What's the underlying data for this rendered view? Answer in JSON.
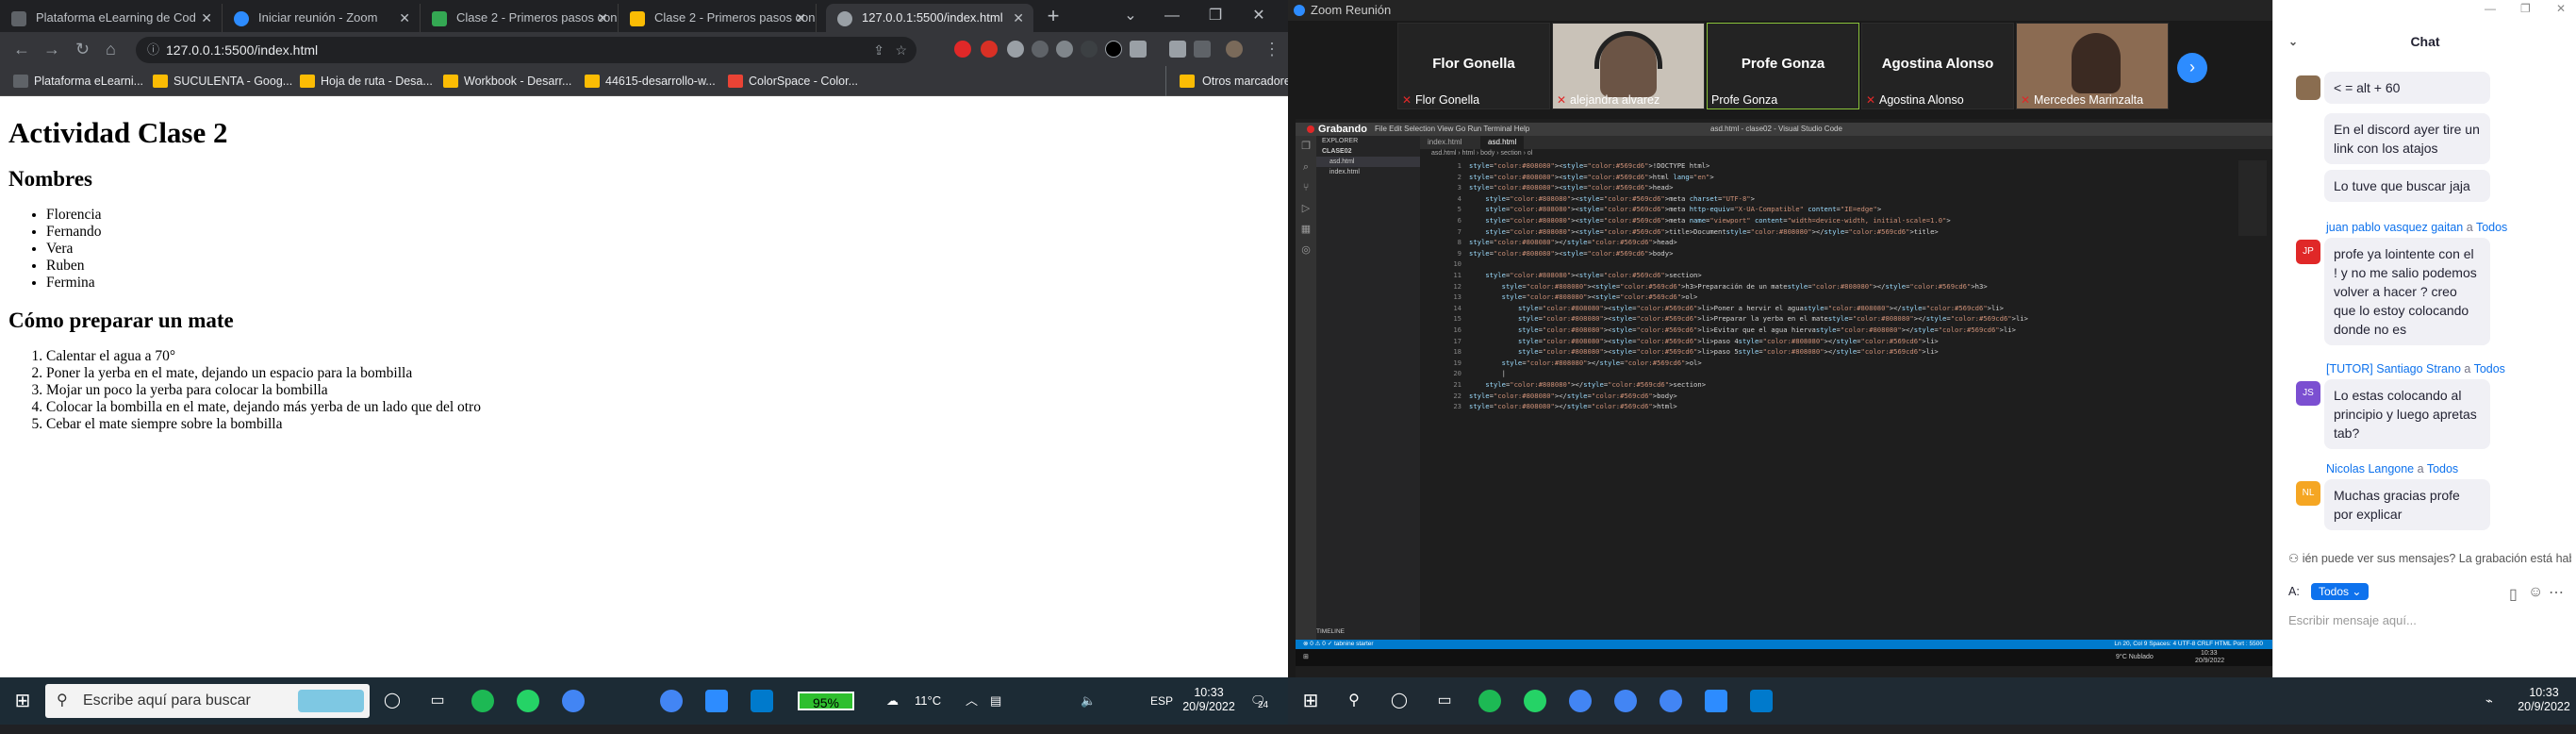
{
  "browser": {
    "tabs": [
      {
        "label": "Plataforma eLearning de Cod",
        "color": "#5f6368"
      },
      {
        "label": "Iniciar reunión - Zoom",
        "color": "#2d8cff"
      },
      {
        "label": "Clase 2 - Primeros pasos con",
        "color": "#34a853"
      },
      {
        "label": "Clase 2 - Primeros pasos con",
        "color": "#fbbc04"
      },
      {
        "label": "127.0.0.1:5500/index.html",
        "color": "#9aa0a6"
      }
    ],
    "new_tab": "+",
    "url": "127.0.0.1:5500/index.html",
    "bookmarks": [
      {
        "label": "Plataforma eLearni...",
        "color": "#5f6368"
      },
      {
        "label": "SUCULENTA - Goog...",
        "color": "#fbbc04"
      },
      {
        "label": "Hoja de ruta - Desa...",
        "color": "#fbbc04"
      },
      {
        "label": "Workbook - Desarr...",
        "color": "#fbbc04"
      },
      {
        "label": "44615-desarrollo-w...",
        "color": "#fbbc04"
      },
      {
        "label": "ColorSpace - Color...",
        "color": "#ea4335"
      }
    ],
    "other_bookmarks": "Otros marcadores"
  },
  "page": {
    "title": "Actividad Clase 2",
    "names_heading": "Nombres",
    "names": [
      "Florencia",
      "Fernando",
      "Vera",
      "Ruben",
      "Fermina"
    ],
    "mate_heading": "Cómo preparar un mate",
    "steps": [
      "Calentar el agua a 70°",
      "Poner la yerba en el mate, dejando un espacio para la bombilla",
      "Mojar un poco la yerba para colocar la bombilla",
      "Colocar la bombilla en el mate, dejando más yerba de un lado que del otro",
      "Cebar el mate siempre sobre la bombilla"
    ]
  },
  "zoom": {
    "window_title": "Zoom Reunión",
    "participants": [
      {
        "big": "Flor Gonella",
        "name": "Flor Gonella",
        "muted": true,
        "video": false
      },
      {
        "big": "",
        "name": "alejandra alvarez",
        "muted": true,
        "video": true
      },
      {
        "big": "Profe Gonza",
        "name": "Profe Gonza",
        "muted": false,
        "video": false
      },
      {
        "big": "Agostina Alonso",
        "name": "Agostina Alonso",
        "muted": true,
        "video": false
      },
      {
        "big": "",
        "name": "Mercedes Marinzalta",
        "muted": true,
        "video": true
      }
    ],
    "next": "›",
    "vscode": {
      "recording": "Grabando",
      "menu": "File  Edit  Selection  View  Go  Run  Terminal  Help",
      "title": "asd.html - clase02 - Visual Studio Code",
      "explorer_title": "EXPLORER",
      "folder": "CLASE02",
      "files": [
        "asd.html",
        "index.html"
      ],
      "tabs": [
        "index.html",
        "asd.html"
      ],
      "breadcrumb": "asd.html › html › body › section › ol",
      "lines": [
        "<!DOCTYPE html>",
        "<html lang=\"en\">",
        "<head>",
        "    <meta charset=\"UTF-8\">",
        "    <meta http-equiv=\"X-UA-Compatible\" content=\"IE=edge\">",
        "    <meta name=\"viewport\" content=\"width=device-width, initial-scale=1.0\">",
        "    <title>Document</title>",
        "</head>",
        "<body>",
        "",
        "    <section>",
        "        <h3>Preparación de un mate</h3>",
        "        <ol>",
        "            <li>Poner a hervir el agua</li>",
        "            <li>Preparar la yerba en el mate</li>",
        "            <li>Evitar que el agua hierva</li>",
        "            <li>paso 4</li>",
        "            <li>paso 5</li>",
        "        </ol>",
        "        |",
        "    </section>",
        "</body>",
        "</html>"
      ],
      "timeline": "TIMELINE",
      "status_left": "⊗ 0 ⚠ 0   ✓ tabnine starter",
      "status_right": "Ln 20, Col 9   Spaces: 4   UTF-8   CRLF   HTML   Port : 5500",
      "remote_clock": "10:33",
      "remote_date": "20/9/2022",
      "remote_weather": "9°C  Nublado"
    }
  },
  "chat": {
    "title": "Chat",
    "messages": [
      {
        "sender": "",
        "to": "",
        "text": "< = alt + 60",
        "avatar": "",
        "avcolor": "#8a6d50"
      },
      {
        "sender": "",
        "to": "",
        "text": "En el discord ayer tire un link con los atajos",
        "avatar": "",
        "avcolor": ""
      },
      {
        "sender": "",
        "to": "",
        "text": "Lo tuve que buscar jaja",
        "avatar": "",
        "avcolor": ""
      },
      {
        "sender": "juan pablo vasquez gaitan",
        "to": "Todos",
        "text": "profe  ya lointente con el ! y no me salio podemos volver a hacer ? creo que lo estoy colocando donde no es",
        "avatar": "JP",
        "avcolor": "#e02828"
      },
      {
        "sender": "[TUTOR] Santiago Strano",
        "to": "Todos",
        "text": "Lo estas colocando al principio y luego apretas tab?",
        "avatar": "JS",
        "avcolor": "#7b4fd1"
      },
      {
        "sender": "Nicolas Langone",
        "to": "Todos",
        "text": "Muchas gracias profe por explicar",
        "avatar": "NL",
        "avcolor": "#f5a623"
      }
    ],
    "a_word": "a",
    "note": "ién puede ver sus mensajes? La grabación está habilit",
    "to_label": "A:",
    "to_value": "Todos",
    "placeholder": "Escribir mensaje aquí..."
  },
  "taskbar_left": {
    "search": "Escribe aquí para buscar",
    "battery": "95%",
    "temperature": "11°C",
    "lang": "ESP",
    "time": "10:33",
    "date": "20/9/2022",
    "notif": "24"
  },
  "taskbar_right": {
    "time": "10:33",
    "date": "20/9/2022"
  }
}
